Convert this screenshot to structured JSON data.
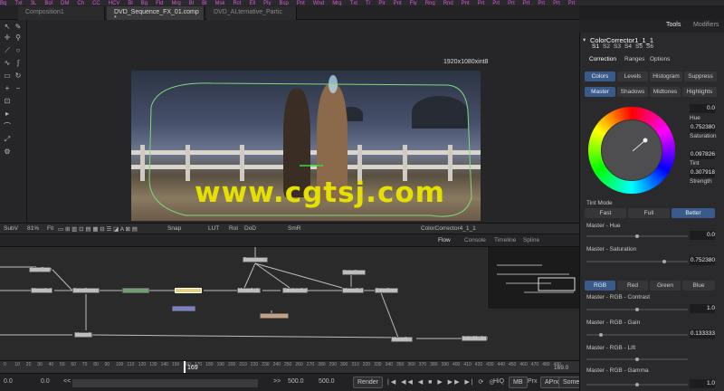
{
  "top_toolbar": {
    "items": [
      "Bg",
      "Txt",
      "3L",
      "Bol",
      "DM",
      "Ch",
      "CC",
      "HCV",
      "Bl",
      "Bg",
      "Fld",
      "Mrg",
      "Bl",
      "Bl",
      "Msk",
      "Rct",
      "Ell",
      "Ply",
      "Bsp",
      "Pnt",
      "Wnd",
      "Mrg",
      "Txt",
      "Tr",
      "Plr",
      "Pnt",
      "Fly",
      "Rng",
      "Rnd",
      "Pnt",
      "Prt",
      "Prt",
      "Prt",
      "Prt",
      "Prt",
      "Prt",
      "Prt"
    ]
  },
  "tabs": [
    {
      "label": "Composition1"
    },
    {
      "label": "DVD_Sequence_FX_01.comp *"
    },
    {
      "label": "DVD_ALternative_Partic"
    }
  ],
  "viewer": {
    "resolution": "1920x1080xint8",
    "bar": [
      "SubV",
      "81%",
      "Fit",
      "Snap",
      "LUT",
      "RoI",
      "DoD",
      "SmR"
    ],
    "node_name": "ColorCorrector4_1_1"
  },
  "watermark": "www.cgtsj.com",
  "flow_tabs": [
    "Flow",
    "Console",
    "Timeline",
    "Spline"
  ],
  "nodes": [
    {
      "label": "ColorCorre"
    },
    {
      "label": "Merge1_1"
    },
    {
      "label": "ColorCorre"
    },
    {
      "label": "Merge1_1"
    },
    {
      "label": "Transform"
    },
    {
      "label": "Merge3"
    },
    {
      "label": "Displace1_1"
    },
    {
      "label": "ColorCorre"
    },
    {
      "label": "Merge2_1"
    },
    {
      "label": "ColorCorre"
    },
    {
      "label": "Merge4"
    },
    {
      "label": "Merge9"
    },
    {
      "label": "Edit_01_Jpg"
    }
  ],
  "timeline": {
    "ticks": [
      "0",
      "10",
      "20",
      "30",
      "40",
      "50",
      "60",
      "70",
      "80",
      "90",
      "100",
      "110",
      "120",
      "130",
      "140",
      "150",
      "160",
      "170",
      "180",
      "190",
      "200",
      "210",
      "220",
      "230",
      "240",
      "250",
      "260",
      "270",
      "280",
      "290",
      "300",
      "310",
      "320",
      "330",
      "340",
      "350",
      "360",
      "370",
      "380",
      "390",
      "400",
      "410",
      "420",
      "430",
      "440",
      "450",
      "460",
      "470",
      "480",
      "490"
    ],
    "current": "169",
    "end_marker": "169.0"
  },
  "transport": {
    "start": "0.0",
    "current": "0.0",
    "back": "<<",
    "fwd": ">>",
    "render_end": "500.0",
    "global_end": "500.0",
    "render_label": "Render",
    "hiq": "HiQ",
    "mb": "MB",
    "prx": "Prx",
    "aprx": "APrx",
    "some": "Some"
  },
  "right": {
    "tabs": [
      "Tools",
      "Modifiers"
    ],
    "tool_name": "ColorCorrector1_1_1",
    "versions": [
      "S1",
      "S2",
      "S3",
      "S4",
      "S5",
      "S6"
    ],
    "subtabs": [
      "Correction",
      "Ranges",
      "Options"
    ],
    "modes": [
      "Colors",
      "Levels",
      "Histogram",
      "Suppress"
    ],
    "ranges": [
      "Master",
      "Shadows",
      "Midtones",
      "Highlights"
    ],
    "hue_value": "0.0",
    "hue_label": "Hue",
    "sat_value": "0.752380",
    "sat_label": "Saturation",
    "tint_value": "0.097826",
    "tint_label": "Tint",
    "strength_value": "0.307918",
    "strength_label": "Strength",
    "tint_mode_label": "Tint Mode",
    "tint_modes": [
      "Fast",
      "Full",
      "Better"
    ],
    "master_hue_label": "Master - Hue",
    "master_hue_value": "0.0",
    "master_sat_label": "Master - Saturation",
    "master_sat_value": "0.752380",
    "channels": [
      "RGB",
      "Red",
      "Green",
      "Blue"
    ],
    "contrast_label": "Master - RGB - Contrast",
    "contrast_value": "1.0",
    "gain_label": "Master - RGB - Gain",
    "gain_value": "0.133333",
    "lift_label": "Master - RGB - Lift",
    "gamma_label": "Master - RGB - Gamma",
    "gamma_value": "1.0"
  },
  "colors": {
    "accent": "#3a5a8a",
    "watermark": "#e5e000",
    "selection": "#b99a3a"
  }
}
